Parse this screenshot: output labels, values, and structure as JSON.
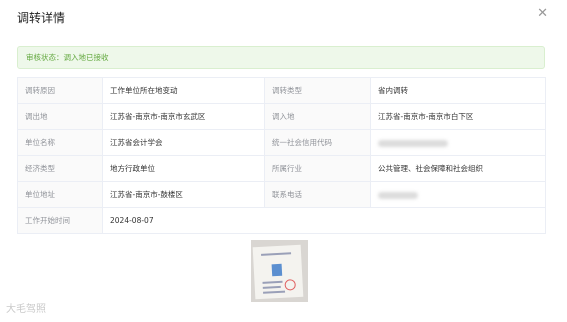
{
  "dialog": {
    "title": "调转详情",
    "close_icon": "close-icon"
  },
  "status": {
    "text": "审核状态：调入地已接收",
    "color": "#62a83e"
  },
  "rows": [
    [
      {
        "label": "调转原因",
        "value": "工作单位所在地变动"
      },
      {
        "label": "调转类型",
        "value": "省内调转"
      }
    ],
    [
      {
        "label": "调出地",
        "value": "江苏省-南京市-南京市玄武区"
      },
      {
        "label": "调入地",
        "value": "江苏省-南京市-南京市白下区"
      }
    ],
    [
      {
        "label": "单位名称",
        "value": "江苏省会计学会"
      },
      {
        "label": "统一社会信用代码",
        "value": ""
      }
    ],
    [
      {
        "label": "经济类型",
        "value": "地方行政单位"
      },
      {
        "label": "所属行业",
        "value": "公共管理、社会保障和社会组织"
      }
    ],
    [
      {
        "label": "单位地址",
        "value": "江苏省-南京市-鼓楼区"
      },
      {
        "label": "联系电话",
        "value": ""
      }
    ],
    [
      {
        "label": "工作开始时间",
        "value": "2024-08-07"
      }
    ]
  ],
  "attachment": {
    "kind": "certificate-photo"
  },
  "watermark": "大毛驾照"
}
